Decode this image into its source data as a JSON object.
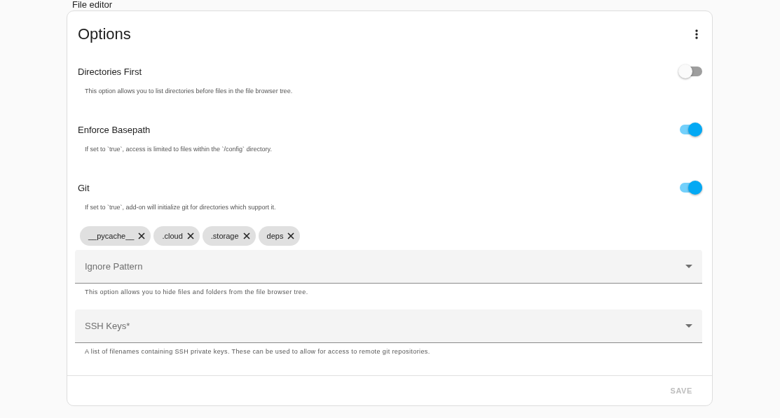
{
  "page_title": "File editor",
  "card": {
    "title": "Options",
    "options": [
      {
        "label": "Directories First",
        "on": false,
        "description": "This option allows you to list directories before files in the file browser tree."
      },
      {
        "label": "Enforce Basepath",
        "on": true,
        "description": "If set to `true`, access is limited to files within the `/config` directory."
      },
      {
        "label": "Git",
        "on": true,
        "description": "If set to `true`, add-on will initialize git for directories which support it."
      }
    ],
    "chips": [
      "__pycache__",
      ".cloud",
      ".storage",
      "deps"
    ],
    "selects": [
      {
        "placeholder": "Ignore Pattern",
        "helper": "This option allows you to hide files and folders from the file browser tree."
      },
      {
        "placeholder": "SSH Keys*",
        "helper": "A list of filenames containing SSH private keys. These can be used to allow for access to remote git repositories."
      }
    ],
    "save_button": {
      "label": "SAVE",
      "disabled": true
    }
  }
}
